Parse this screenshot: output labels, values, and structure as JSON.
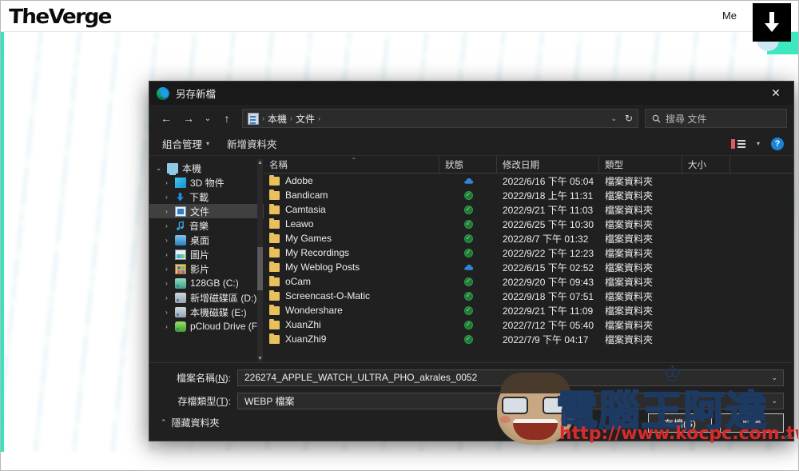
{
  "site": {
    "logo_text": "TheVerge",
    "menu_label": "Me",
    "download_icon": "download-arrow-icon"
  },
  "dialog": {
    "title": "另存新檔",
    "app_icon": "edge-browser-icon",
    "close_label": "✕",
    "nav": {
      "back_icon": "←",
      "forward_icon": "→",
      "recent_icon": "⌄",
      "up_icon": "↑",
      "refresh_icon": "↻",
      "breadcrumb_icon": "documents-folder-icon",
      "breadcrumb": [
        "本機",
        "文件"
      ],
      "breadcrumb_sep": "›",
      "dropdown_caret": "⌄"
    },
    "search": {
      "placeholder": "搜尋 文件",
      "icon": "search-icon"
    },
    "toolbar": {
      "organize_label": "組合管理",
      "organize_caret": "▾",
      "new_folder_label": "新增資料夾",
      "view_icon": "view-layout-icon",
      "view_caret": "▾",
      "help_label": "?"
    },
    "nav_pane": {
      "items": [
        {
          "label": "本機",
          "icon": "computer-icon",
          "twisty": "⌄",
          "level": 0,
          "selected": false
        },
        {
          "label": "3D 物件",
          "icon": "3d-objects-icon",
          "twisty": "›",
          "level": 1,
          "selected": false
        },
        {
          "label": "下載",
          "icon": "downloads-icon",
          "twisty": "›",
          "level": 1,
          "selected": false
        },
        {
          "label": "文件",
          "icon": "documents-icon",
          "twisty": "›",
          "level": 1,
          "selected": true
        },
        {
          "label": "音樂",
          "icon": "music-icon",
          "twisty": "›",
          "level": 1,
          "selected": false
        },
        {
          "label": "桌面",
          "icon": "desktop-icon",
          "twisty": "›",
          "level": 1,
          "selected": false
        },
        {
          "label": "圖片",
          "icon": "pictures-icon",
          "twisty": "›",
          "level": 1,
          "selected": false
        },
        {
          "label": "影片",
          "icon": "videos-icon",
          "twisty": "›",
          "level": 1,
          "selected": false
        },
        {
          "label": "128GB (C:)",
          "icon": "system-drive-icon",
          "twisty": "›",
          "level": 1,
          "selected": false
        },
        {
          "label": "新增磁碟區 (D:)",
          "icon": "drive-icon",
          "twisty": "›",
          "level": 1,
          "selected": false
        },
        {
          "label": "本機磁碟 (E:)",
          "icon": "drive-icon",
          "twisty": "›",
          "level": 1,
          "selected": false
        },
        {
          "label": "pCloud Drive (F",
          "icon": "pcloud-drive-icon",
          "twisty": "›",
          "level": 1,
          "selected": false
        }
      ]
    },
    "columns": [
      {
        "key": "name",
        "label": "名稱"
      },
      {
        "key": "state",
        "label": "狀態"
      },
      {
        "key": "date",
        "label": "修改日期"
      },
      {
        "key": "type",
        "label": "類型"
      },
      {
        "key": "size",
        "label": "大小"
      }
    ],
    "sort_indicator": "⌃",
    "files": [
      {
        "name": "Adobe",
        "state": "cloud",
        "date": "2022/6/16 下午 05:04",
        "type": "檔案資料夾",
        "size": ""
      },
      {
        "name": "Bandicam",
        "state": "ok",
        "date": "2022/9/18 上午 11:31",
        "type": "檔案資料夾",
        "size": ""
      },
      {
        "name": "Camtasia",
        "state": "ok",
        "date": "2022/9/21 下午 11:03",
        "type": "檔案資料夾",
        "size": ""
      },
      {
        "name": "Leawo",
        "state": "ok",
        "date": "2022/6/25 下午 10:30",
        "type": "檔案資料夾",
        "size": ""
      },
      {
        "name": "My Games",
        "state": "ok",
        "date": "2022/8/7 下午 01:32",
        "type": "檔案資料夾",
        "size": ""
      },
      {
        "name": "My Recordings",
        "state": "ok",
        "date": "2022/9/22 下午 12:23",
        "type": "檔案資料夾",
        "size": ""
      },
      {
        "name": "My Weblog Posts",
        "state": "cloud",
        "date": "2022/6/15 下午 02:52",
        "type": "檔案資料夾",
        "size": ""
      },
      {
        "name": "oCam",
        "state": "ok",
        "date": "2022/9/20 下午 09:43",
        "type": "檔案資料夾",
        "size": ""
      },
      {
        "name": "Screencast-O-Matic",
        "state": "ok",
        "date": "2022/9/18 下午 07:51",
        "type": "檔案資料夾",
        "size": ""
      },
      {
        "name": "Wondershare",
        "state": "ok",
        "date": "2022/9/21 下午 11:09",
        "type": "檔案資料夾",
        "size": ""
      },
      {
        "name": "XuanZhi",
        "state": "ok",
        "date": "2022/7/12 下午 05:40",
        "type": "檔案資料夾",
        "size": ""
      },
      {
        "name": "XuanZhi9",
        "state": "ok",
        "date": "2022/7/9 下午 04:17",
        "type": "檔案資料夾",
        "size": ""
      }
    ],
    "footer": {
      "filename_label_pre": "檔案名稱(",
      "filename_label_key": "N",
      "filename_label_post": "):",
      "filename_value": "226274_APPLE_WATCH_ULTRA_PHO_akrales_0052",
      "filetype_label_pre": "存檔類型(",
      "filetype_label_key": "T",
      "filetype_label_post": "):",
      "filetype_value": "WEBP 檔案",
      "combo_chevron": "⌄",
      "hide_folders_label": "隱藏資料夾",
      "hide_folders_caret": "⌃",
      "save_label": "存檔(S)",
      "cancel_label": "取消"
    }
  },
  "watermark": {
    "text": "電腦王阿達",
    "url": "http://www.kocpc.com.tw",
    "crown": "♔"
  },
  "colors": {
    "accent_teal": "#34e6bd",
    "dialog_bg": "#202020",
    "folder_yellow": "#e8c15c",
    "status_ok_green": "#2e9a49",
    "status_cloud_blue": "#2f86d8",
    "help_blue": "#1a84d8",
    "watermark_navy": "#1d3a63",
    "watermark_red": "#d92b2b"
  }
}
